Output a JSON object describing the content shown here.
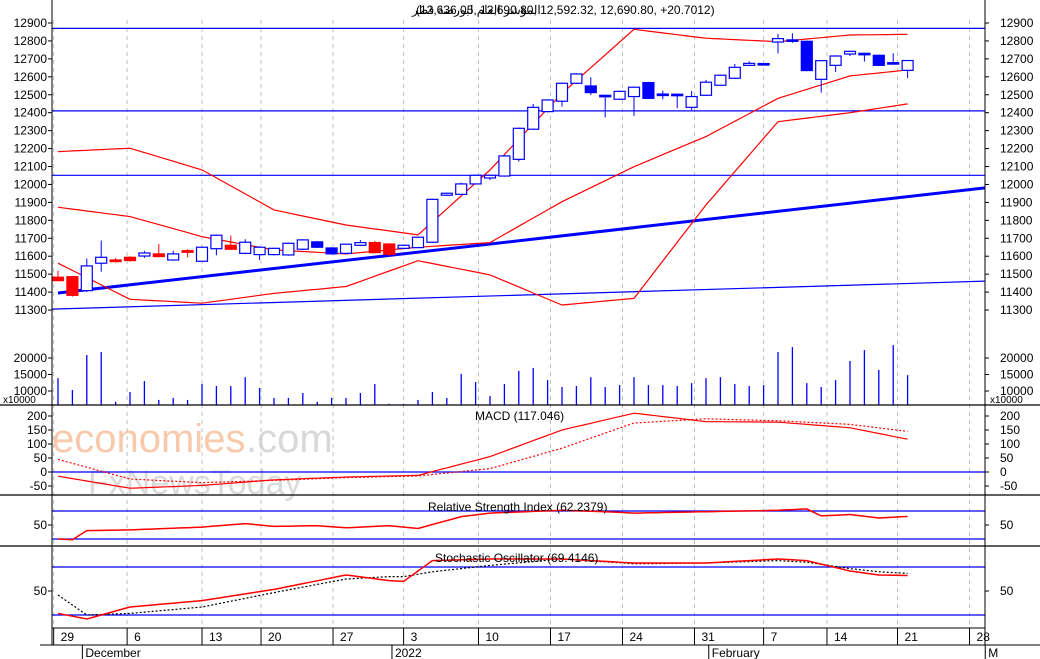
{
  "chart_data": {
    "type": "candlestick",
    "title": "المؤشر العام لبورصة قطر",
    "title_values": "(12,636.05, 12,690.80, 12,592.32, 12,690.80, +20.7012)",
    "watermark": [
      "economies",
      ".com",
      "FxNewsToday"
    ],
    "colors": {
      "up": "#0000ff",
      "down_blue": "#0000ff",
      "down_red": "#ff0000",
      "indicator": "#ff0000",
      "line": "#0000ff",
      "grid": "#c0c0c0"
    },
    "price_axis": {
      "min": 11300,
      "max": 12900,
      "step": 100
    },
    "candles": [
      [
        11483,
        11520,
        11460,
        11464,
        "red"
      ],
      [
        11486,
        11490,
        11375,
        11382,
        "red"
      ],
      [
        11408,
        11587,
        11400,
        11546,
        "up"
      ],
      [
        11561,
        11687,
        11514,
        11594,
        "up"
      ],
      [
        11579,
        11590,
        11565,
        11570,
        "red"
      ],
      [
        11594,
        11600,
        11570,
        11576,
        "red"
      ],
      [
        11601,
        11630,
        11590,
        11618,
        "up"
      ],
      [
        11613,
        11668,
        11595,
        11598,
        "red"
      ],
      [
        11579,
        11630,
        11575,
        11613,
        "up"
      ],
      [
        11631,
        11640,
        11594,
        11622,
        "red"
      ],
      [
        11572,
        11655,
        11570,
        11650,
        "up"
      ],
      [
        11642,
        11720,
        11605,
        11717,
        "up"
      ],
      [
        11661,
        11715,
        11635,
        11639,
        "red"
      ],
      [
        11616,
        11695,
        11612,
        11678,
        "up"
      ],
      [
        11609,
        11655,
        11579,
        11650,
        "up"
      ],
      [
        11609,
        11648,
        11605,
        11644,
        "up"
      ],
      [
        11607,
        11676,
        11603,
        11672,
        "up"
      ],
      [
        11639,
        11695,
        11635,
        11691,
        "up"
      ],
      [
        11680,
        11684,
        11646,
        11650,
        "blue"
      ],
      [
        11646,
        11650,
        11609,
        11613,
        "blue"
      ],
      [
        11616,
        11671,
        11612,
        11667,
        "up"
      ],
      [
        11661,
        11690,
        11657,
        11676,
        "up"
      ],
      [
        11676,
        11685,
        11616,
        11620,
        "red"
      ],
      [
        11668,
        11672,
        11600,
        11611,
        "red"
      ],
      [
        11644,
        11665,
        11640,
        11661,
        "up"
      ],
      [
        11648,
        11710,
        11644,
        11706,
        "up"
      ],
      [
        11678,
        11921,
        11674,
        11917,
        "up"
      ],
      [
        11940,
        11955,
        11936,
        11951,
        "up"
      ],
      [
        11945,
        12010,
        11941,
        12003,
        "up"
      ],
      [
        12003,
        12055,
        11999,
        12051,
        "up"
      ],
      [
        12036,
        12055,
        12025,
        12051,
        "up"
      ],
      [
        12047,
        12163,
        12043,
        12159,
        "up"
      ],
      [
        12140,
        12317,
        12127,
        12313,
        "up"
      ],
      [
        12308,
        12449,
        12304,
        12430,
        "up"
      ],
      [
        12406,
        12475,
        12402,
        12471,
        "up"
      ],
      [
        12464,
        12568,
        12434,
        12564,
        "up"
      ],
      [
        12564,
        12620,
        12560,
        12616,
        "up"
      ],
      [
        12549,
        12597,
        12499,
        12512,
        "blue"
      ],
      [
        12497,
        12501,
        12374,
        12490,
        "blue"
      ],
      [
        12475,
        12523,
        12471,
        12519,
        "up"
      ],
      [
        12490,
        12546,
        12382,
        12542,
        "up"
      ],
      [
        12568,
        12572,
        12476,
        12480,
        "blue"
      ],
      [
        12504,
        12523,
        12475,
        12497,
        "blue"
      ],
      [
        12503,
        12507,
        12425,
        12497,
        "blue"
      ],
      [
        12430,
        12521,
        12415,
        12490,
        "up"
      ],
      [
        12497,
        12583,
        12493,
        12570,
        "up"
      ],
      [
        12553,
        12613,
        12549,
        12609,
        "up"
      ],
      [
        12592,
        12672,
        12588,
        12653,
        "up"
      ],
      [
        12664,
        12687,
        12660,
        12675,
        "up"
      ],
      [
        12674,
        12678,
        12666,
        12670,
        "blue"
      ],
      [
        12794,
        12839,
        12731,
        12813,
        "up"
      ],
      [
        12806,
        12843,
        12790,
        12802,
        "blue"
      ],
      [
        12798,
        12802,
        12631,
        12635,
        "blue"
      ],
      [
        12586,
        12694,
        12512,
        12690,
        "up"
      ],
      [
        12664,
        12720,
        12627,
        12716,
        "up"
      ],
      [
        12727,
        12746,
        12716,
        12742,
        "up"
      ],
      [
        12731,
        12735,
        12685,
        12726,
        "blue"
      ],
      [
        12720,
        12724,
        12660,
        12664,
        "blue"
      ],
      [
        12679,
        12731,
        12668,
        12672,
        "blue"
      ],
      [
        12636.05,
        12690.8,
        12592.32,
        12690.8,
        "up"
      ]
    ],
    "bollinger": {
      "index": [
        0,
        5,
        10,
        15,
        20,
        25,
        30,
        35,
        40,
        45,
        50,
        55,
        59
      ],
      "upper": [
        12183,
        12202,
        12081,
        11858,
        11774,
        11719,
        12081,
        12508,
        12865,
        12815,
        12796,
        12833,
        12837
      ],
      "middle": [
        11873,
        11821,
        11709,
        11635,
        11613,
        11650,
        11676,
        11904,
        12099,
        12267,
        12480,
        12605,
        12638
      ],
      "lower": [
        11561,
        11360,
        11338,
        11393,
        11431,
        11575,
        11496,
        11328,
        11365,
        11886,
        12350,
        12400,
        12449
      ]
    },
    "horizontal_levels": [
      12870,
      12410,
      12051
    ],
    "trendlines": [
      {
        "from": [
          0,
          11395
        ],
        "to": [
          64.8,
          11985
        ],
        "weight": "thick"
      },
      {
        "from": [
          -0.4,
          11305
        ],
        "to": [
          64.8,
          11462
        ],
        "weight": "thin"
      }
    ],
    "volume": {
      "unit_label": "x10000",
      "ticks": [
        10000,
        15000,
        20000
      ],
      "values": [
        13900,
        10300,
        20900,
        21800,
        6700,
        9700,
        13000,
        7300,
        7900,
        7300,
        12100,
        11500,
        11500,
        14200,
        10900,
        7900,
        7900,
        9400,
        6700,
        7900,
        7900,
        9400,
        12100,
        6100,
        6100,
        7300,
        9700,
        7900,
        15200,
        12700,
        8500,
        12100,
        16100,
        17000,
        13300,
        11200,
        11500,
        14200,
        11200,
        11800,
        14200,
        11800,
        11800,
        11500,
        12400,
        13900,
        14200,
        12100,
        11500,
        11800,
        21800,
        23300,
        12400,
        11200,
        13300,
        19100,
        22400,
        16400,
        23900,
        14800
      ]
    },
    "macd": {
      "label": "MACD (117.046)",
      "ticks": [
        -50,
        0,
        50,
        100,
        150,
        200
      ],
      "index": [
        0,
        5,
        10,
        15,
        20,
        25,
        30,
        35,
        40,
        45,
        50,
        55,
        59
      ],
      "macd": [
        -15,
        -58,
        -48,
        -28,
        -18,
        -12,
        55,
        150,
        210,
        180,
        178,
        158,
        117
      ],
      "signal": [
        45,
        -25,
        -38,
        -30,
        -20,
        -14,
        12,
        85,
        175,
        190,
        183,
        170,
        145
      ]
    },
    "rsi": {
      "label": "Relative Strength Index (62.2379)",
      "ticks": [
        50
      ],
      "levels": [
        70,
        30
      ],
      "index": [
        0,
        1,
        2,
        5,
        10,
        13,
        15,
        18,
        20,
        23,
        25,
        28,
        30,
        35,
        38,
        40,
        45,
        50,
        52,
        53,
        55,
        57,
        59
      ],
      "values": [
        30,
        29,
        42,
        43,
        47,
        52,
        48,
        49,
        46,
        49,
        45,
        62,
        67,
        71,
        69,
        67,
        69,
        71,
        73,
        63,
        65,
        60,
        62.2
      ]
    },
    "stochastic": {
      "label": "Stochastic Oscillator (69.4146)",
      "ticks": [
        50
      ],
      "levels": [
        80,
        20
      ],
      "index": [
        0,
        2,
        5,
        10,
        15,
        20,
        23,
        24,
        26,
        30,
        35,
        40,
        45,
        50,
        52,
        55,
        57,
        59
      ],
      "k": [
        22,
        15,
        30,
        38,
        52,
        70,
        63,
        62,
        88,
        90,
        90,
        85,
        85,
        90,
        88,
        75,
        70,
        69.4
      ],
      "d": [
        45,
        20,
        22,
        30,
        48,
        65,
        68,
        68,
        74,
        82,
        90,
        84,
        85,
        88,
        86,
        78,
        74,
        72
      ]
    },
    "x_ticks": [
      {
        "label": "29",
        "index": -0.3
      },
      {
        "label": "6",
        "index": 4.8
      },
      {
        "label": "13",
        "index": 10
      },
      {
        "label": "20",
        "index": 14.1
      },
      {
        "label": "27",
        "index": 19.1
      },
      {
        "label": "3",
        "index": 24
      },
      {
        "label": "10",
        "index": 29.2
      },
      {
        "label": "17",
        "index": 34.2
      },
      {
        "label": "24",
        "index": 39.2
      },
      {
        "label": "31",
        "index": 44.2
      },
      {
        "label": "7",
        "index": 49
      },
      {
        "label": "14",
        "index": 53.4
      },
      {
        "label": "21",
        "index": 58.3
      },
      {
        "label": "28",
        "index": 63.3
      }
    ],
    "x_months": [
      {
        "label": "December",
        "index": 1.9
      },
      {
        "label": "2022",
        "index": 23.4
      },
      {
        "label": "February",
        "index": 45.4
      },
      {
        "label": "M",
        "index": 64.6
      }
    ]
  }
}
